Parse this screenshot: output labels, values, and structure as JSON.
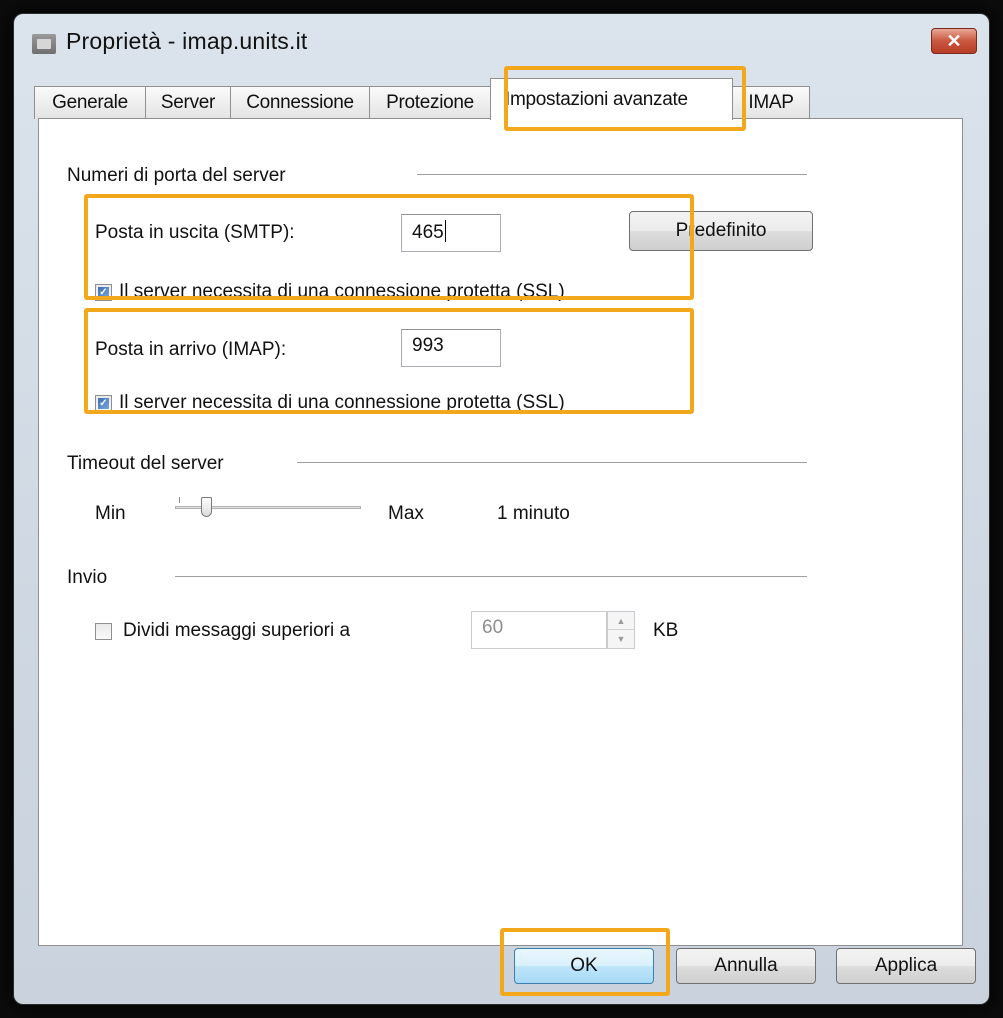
{
  "window": {
    "title": "Proprietà - imap.units.it",
    "close_label": "✕"
  },
  "tabs": [
    {
      "label": "Generale"
    },
    {
      "label": "Server"
    },
    {
      "label": "Connessione"
    },
    {
      "label": "Protezione"
    },
    {
      "label": "Impostazioni avanzate",
      "active": true
    },
    {
      "label": "IMAP"
    }
  ],
  "ports": {
    "group_label": "Numeri di porta del server",
    "smtp_label": "Posta in uscita (SMTP):",
    "smtp_value": "465",
    "smtp_ssl_label": "Il server necessita di una connessione protetta (SSL)",
    "smtp_ssl_checked": true,
    "default_button": "Predefinito",
    "imap_label": "Posta in arrivo (IMAP):",
    "imap_value": "993",
    "imap_ssl_label": "Il server necessita di una connessione protetta (SSL)",
    "imap_ssl_checked": true
  },
  "timeout": {
    "group_label": "Timeout del server",
    "min_label": "Min",
    "max_label": "Max",
    "value_label": "1 minuto",
    "level": 0.15
  },
  "sending": {
    "group_label": "Invio",
    "split_label": "Dividi messaggi superiori a",
    "split_checked": false,
    "split_value": "60",
    "unit": "KB"
  },
  "footer": {
    "ok": "OK",
    "cancel": "Annulla",
    "apply": "Applica"
  },
  "colors": {
    "highlight": "#f3a81c",
    "close_button": "#c9573f"
  }
}
